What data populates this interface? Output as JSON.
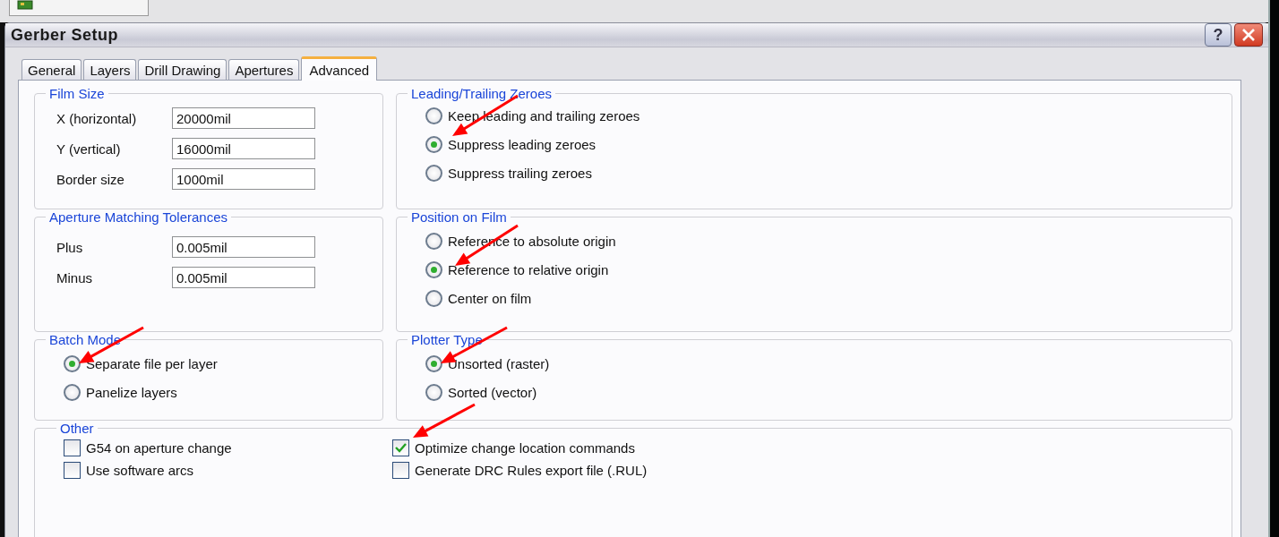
{
  "window": {
    "title": "Gerber Setup",
    "help_button": "?"
  },
  "tabs": [
    {
      "label": "General",
      "selected": false
    },
    {
      "label": "Layers",
      "selected": false
    },
    {
      "label": "Drill Drawing",
      "selected": false
    },
    {
      "label": "Apertures",
      "selected": false
    },
    {
      "label": "Advanced",
      "selected": true
    }
  ],
  "film_size": {
    "title": "Film Size",
    "fields": [
      {
        "label": "X (horizontal)",
        "value": "20000mil"
      },
      {
        "label": "Y (vertical)",
        "value": "16000mil"
      },
      {
        "label": "Border size",
        "value": "1000mil"
      }
    ]
  },
  "leading_trailing_zeroes": {
    "title": "Leading/Trailing Zeroes",
    "options": [
      {
        "label": "Keep leading and trailing zeroes",
        "selected": false
      },
      {
        "label": "Suppress leading zeroes",
        "selected": true
      },
      {
        "label": "Suppress trailing zeroes",
        "selected": false
      }
    ]
  },
  "aperture_matching_tolerances": {
    "title": "Aperture Matching Tolerances",
    "fields": [
      {
        "label": "Plus",
        "value": "0.005mil"
      },
      {
        "label": "Minus",
        "value": "0.005mil"
      }
    ]
  },
  "position_on_film": {
    "title": "Position on Film",
    "options": [
      {
        "label": "Reference to absolute origin",
        "selected": false
      },
      {
        "label": "Reference to relative origin",
        "selected": true
      },
      {
        "label": "Center on film",
        "selected": false
      }
    ]
  },
  "batch_mode": {
    "title": "Batch Mode",
    "options": [
      {
        "label": "Separate file per layer",
        "selected": true
      },
      {
        "label": "Panelize layers",
        "selected": false
      }
    ]
  },
  "plotter_type": {
    "title": "Plotter Type",
    "options": [
      {
        "label": "Unsorted (raster)",
        "selected": true
      },
      {
        "label": "Sorted (vector)",
        "selected": false
      }
    ]
  },
  "other": {
    "title": "Other",
    "options": [
      {
        "label": "G54 on aperture change",
        "checked": false
      },
      {
        "label": "Optimize change location commands",
        "checked": true
      },
      {
        "label": "Use software arcs",
        "checked": false
      },
      {
        "label": "Generate DRC Rules export file (.RUL)",
        "checked": false
      }
    ]
  }
}
